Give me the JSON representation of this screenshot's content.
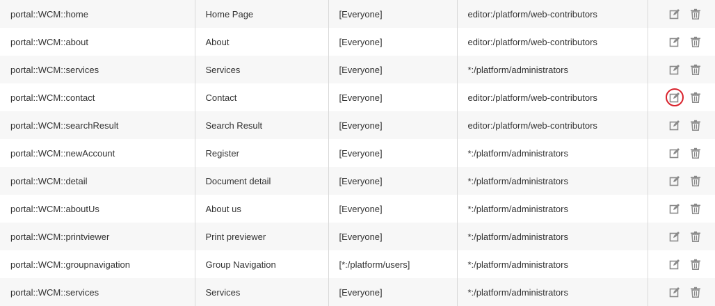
{
  "rows": [
    {
      "page_id": "portal::WCM::home",
      "title": "Home Page",
      "access": "[Everyone]",
      "edit_permission": "editor:/platform/web-contributors",
      "highlighted": false
    },
    {
      "page_id": "portal::WCM::about",
      "title": "About",
      "access": "[Everyone]",
      "edit_permission": "editor:/platform/web-contributors",
      "highlighted": false
    },
    {
      "page_id": "portal::WCM::services",
      "title": "Services",
      "access": "[Everyone]",
      "edit_permission": "*:/platform/administrators",
      "highlighted": false
    },
    {
      "page_id": "portal::WCM::contact",
      "title": "Contact",
      "access": "[Everyone]",
      "edit_permission": "editor:/platform/web-contributors",
      "highlighted": true
    },
    {
      "page_id": "portal::WCM::searchResult",
      "title": "Search Result",
      "access": "[Everyone]",
      "edit_permission": "editor:/platform/web-contributors",
      "highlighted": false
    },
    {
      "page_id": "portal::WCM::newAccount",
      "title": "Register",
      "access": "[Everyone]",
      "edit_permission": "*:/platform/administrators",
      "highlighted": false
    },
    {
      "page_id": "portal::WCM::detail",
      "title": "Document detail",
      "access": "[Everyone]",
      "edit_permission": "*:/platform/administrators",
      "highlighted": false
    },
    {
      "page_id": "portal::WCM::aboutUs",
      "title": "About us",
      "access": "[Everyone]",
      "edit_permission": "*:/platform/administrators",
      "highlighted": false
    },
    {
      "page_id": "portal::WCM::printviewer",
      "title": "Print previewer",
      "access": "[Everyone]",
      "edit_permission": "*:/platform/administrators",
      "highlighted": false
    },
    {
      "page_id": "portal::WCM::groupnavigation",
      "title": "Group Navigation",
      "access": "[*:/platform/users]",
      "edit_permission": "*:/platform/administrators",
      "highlighted": false
    },
    {
      "page_id": "portal::WCM::services",
      "title": "Services",
      "access": "[Everyone]",
      "edit_permission": "*:/platform/administrators",
      "highlighted": false
    }
  ],
  "icons": {
    "edit": "edit-icon",
    "delete": "trash-icon"
  },
  "colors": {
    "icon": "#8a8a8a",
    "highlight_ring": "#d9232d",
    "row_odd": "#f7f7f7",
    "row_even": "#ffffff"
  }
}
